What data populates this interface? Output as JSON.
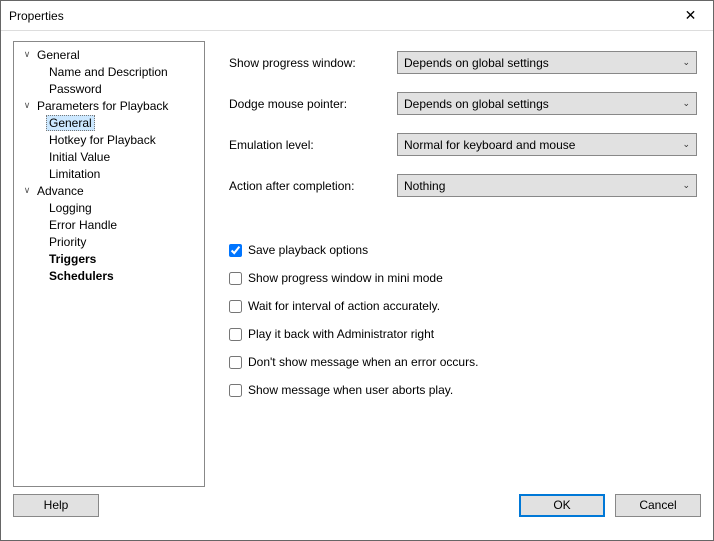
{
  "window": {
    "title": "Properties",
    "close_icon": "✕"
  },
  "tree": {
    "items": [
      {
        "label": "General",
        "level": 0,
        "expanded": true
      },
      {
        "label": "Name and Description",
        "level": 1
      },
      {
        "label": "Password",
        "level": 1
      },
      {
        "label": "Parameters for Playback",
        "level": 0,
        "expanded": true
      },
      {
        "label": "General",
        "level": 1,
        "selected": true
      },
      {
        "label": "Hotkey for Playback",
        "level": 1
      },
      {
        "label": "Initial Value",
        "level": 1
      },
      {
        "label": "Limitation",
        "level": 1
      },
      {
        "label": "Advance",
        "level": 0,
        "expanded": true
      },
      {
        "label": "Logging",
        "level": 1
      },
      {
        "label": "Error Handle",
        "level": 1
      },
      {
        "label": "Priority",
        "level": 1
      },
      {
        "label": "Triggers",
        "level": 1,
        "bold": true
      },
      {
        "label": "Schedulers",
        "level": 1,
        "bold": true
      }
    ]
  },
  "form": {
    "rows": [
      {
        "label": "Show progress window:",
        "value": "Depends on global settings"
      },
      {
        "label": "Dodge mouse pointer:",
        "value": "Depends on global settings"
      },
      {
        "label": "Emulation level:",
        "value": "Normal for keyboard and mouse"
      },
      {
        "label": "Action after completion:",
        "value": "Nothing"
      }
    ],
    "checks": [
      {
        "label": "Save playback options",
        "checked": true
      },
      {
        "label": "Show progress window in mini mode",
        "checked": false
      },
      {
        "label": "Wait for interval of action accurately.",
        "checked": false
      },
      {
        "label": "Play it back with Administrator right",
        "checked": false
      },
      {
        "label": "Don't show message when an error occurs.",
        "checked": false
      },
      {
        "label": "Show message when user aborts play.",
        "checked": false
      }
    ]
  },
  "footer": {
    "help": "Help",
    "ok": "OK",
    "cancel": "Cancel"
  }
}
